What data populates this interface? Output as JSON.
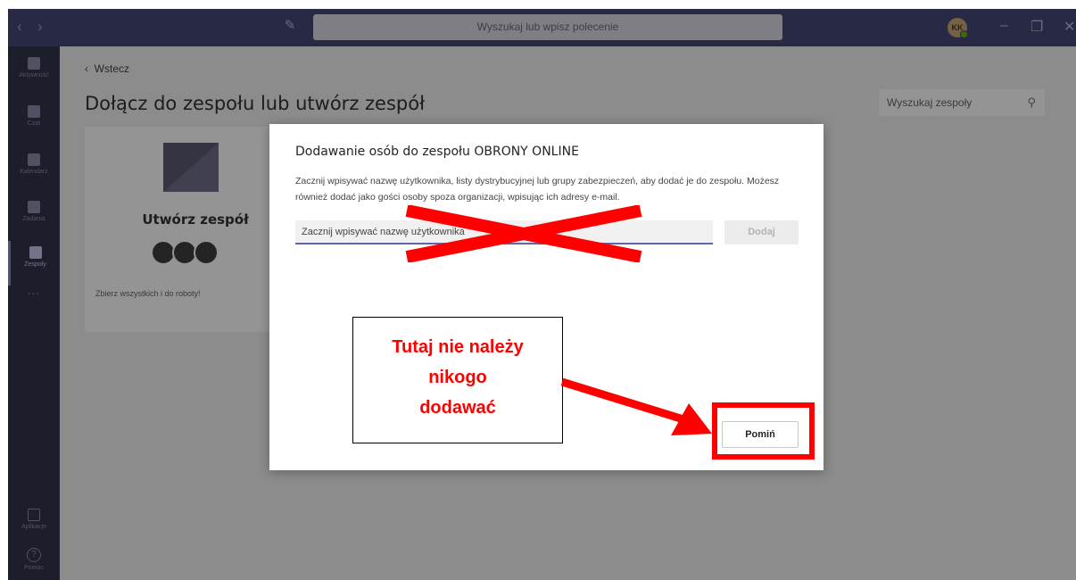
{
  "titlebar": {
    "search_placeholder": "Wyszukaj lub wpisz polecenie",
    "avatar_initials": "KK",
    "back_arrow_icon": "chevron-left-icon",
    "forward_arrow_icon": "chevron-right-icon",
    "compose_icon": "compose-icon",
    "minimize_icon": "minimize-icon",
    "restore_icon": "restore-icon",
    "close_icon": "close-icon",
    "accent": "#464775"
  },
  "rail": {
    "items": [
      {
        "label": "Aktywność",
        "icon": "bell-icon"
      },
      {
        "label": "Czat",
        "icon": "chat-icon"
      },
      {
        "label": "Kalendarz",
        "icon": "calendar-icon"
      },
      {
        "label": "Zadania",
        "icon": "assignments-icon"
      },
      {
        "label": "Zespoły",
        "icon": "teams-icon"
      }
    ],
    "more": "...",
    "apps_label": "Aplikacje",
    "help_label": "Pomoc",
    "help_glyph": "?",
    "color": "#33344a"
  },
  "main": {
    "back_label": "Wstecz",
    "title": "Dołącz do zespołu lub utwórz zespół",
    "team_search_placeholder": "Wyszukaj zespoły",
    "card": {
      "title": "Utwórz zespół",
      "description": "Zbierz wszystkich i do roboty!"
    }
  },
  "dialog": {
    "title": "Dodawanie osób do zespołu OBRONY ONLINE",
    "body": "Zacznij wpisywać nazwę użytkownika, listy dystrybucyjnej lub grupy zabezpieczeń, aby dodać je do zespołu. Możesz również dodać jako gości osoby spoza organizacji, wpisując ich adresy e-mail.",
    "input_placeholder": "Zacznij wpisywać nazwę użytkownika",
    "add_button": "Dodaj",
    "skip_button": "Pomiń"
  },
  "annotation": {
    "lines": [
      "Tutaj nie należy",
      "nikogo",
      "dodawać"
    ],
    "color": "#ff0000"
  }
}
